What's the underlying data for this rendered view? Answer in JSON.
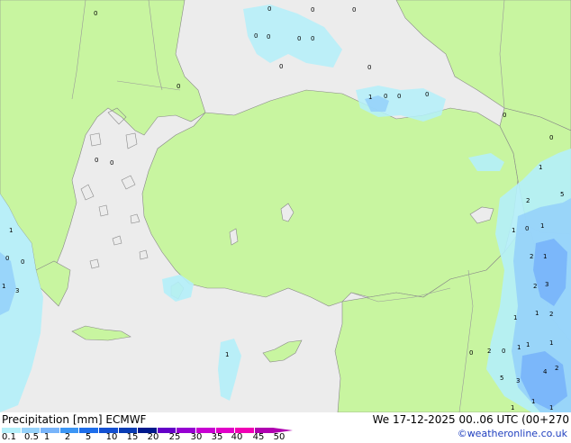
{
  "legend": {
    "title": "Precipitation [mm]  ECMWF",
    "date": "We 17-12-2025 00..06 UTC (00+270",
    "credit": "©weatheronline.co.uk",
    "scale_labels": [
      "0.1",
      "0.5",
      "1",
      "2",
      "5",
      "10",
      "15",
      "20",
      "25",
      "30",
      "35",
      "40",
      "45",
      "50"
    ],
    "scale_colors": [
      "#b4f0fa",
      "#96d2fa",
      "#78b4fa",
      "#3c96f5",
      "#1e6eeb",
      "#1450d2",
      "#0a3cb4",
      "#00198c",
      "#6400c8",
      "#9600d2",
      "#c800d2",
      "#e100c8",
      "#f000b4",
      "#b000b0"
    ]
  },
  "colors": {
    "land": "#c8f5a0",
    "sea": "#ececec",
    "precip_light": "#b4f0fa",
    "precip_medium": "#96d2fa",
    "precip_heavy": "#78b4fa"
  },
  "map_labels": [
    "0",
    "0",
    "0",
    "0",
    "0",
    "0",
    "0",
    "0",
    "0",
    "0",
    "1",
    "0",
    "0",
    "0",
    "0",
    "0",
    "0",
    "0",
    "0",
    "1",
    "1",
    "0",
    "0",
    "3",
    "1",
    "2",
    "1",
    "0",
    "1",
    "2",
    "1",
    "2",
    "3",
    "5",
    "1",
    "1",
    "2",
    "1",
    "0",
    "2",
    "0",
    "1",
    "1",
    "5",
    "3",
    "4",
    "2",
    "1",
    "1",
    "1",
    "1"
  ]
}
